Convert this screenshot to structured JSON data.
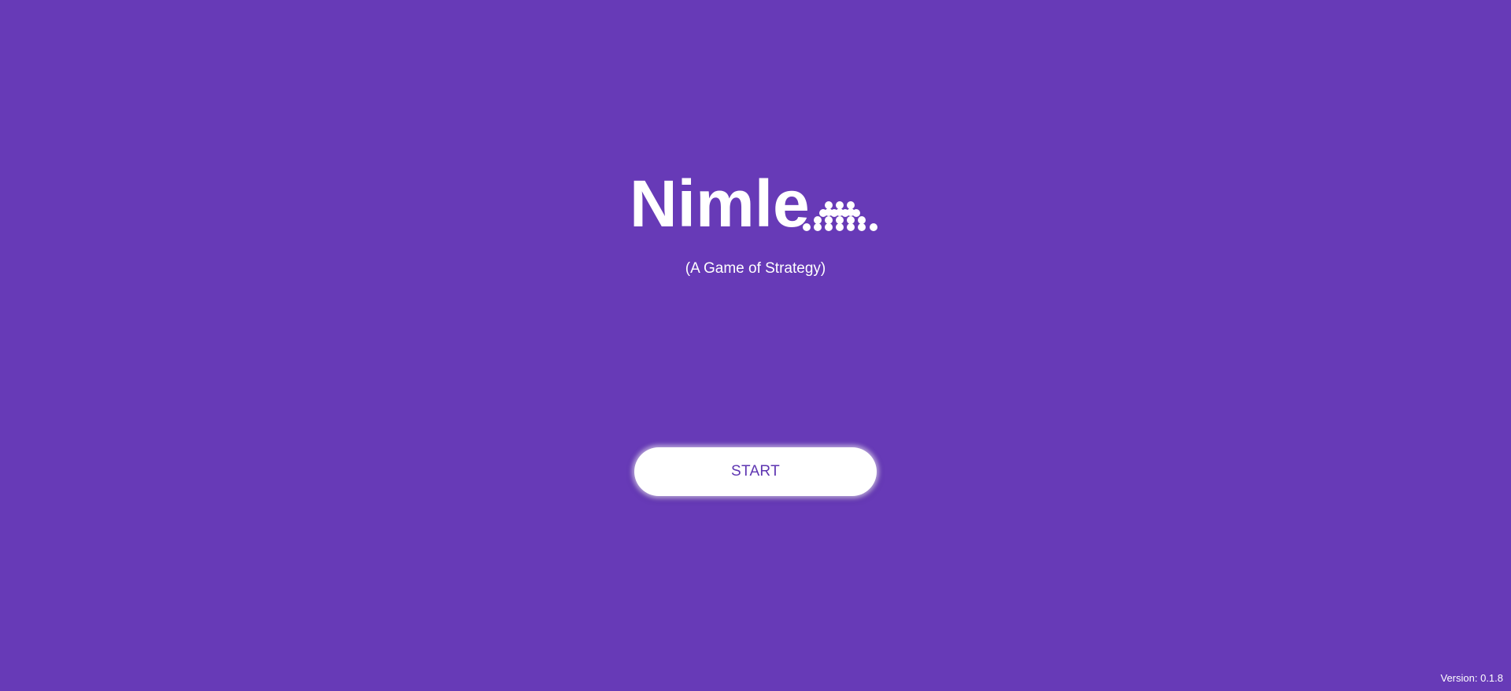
{
  "app": {
    "title": "Nimle",
    "subtitle": "(A Game of Strategy)",
    "logo_icon": "nim-dots-icon",
    "background_color": "#673ab7",
    "accent_color": "#5e35b1"
  },
  "start": {
    "label": "START"
  },
  "footer": {
    "version_text": "Version: 0.1.8"
  }
}
